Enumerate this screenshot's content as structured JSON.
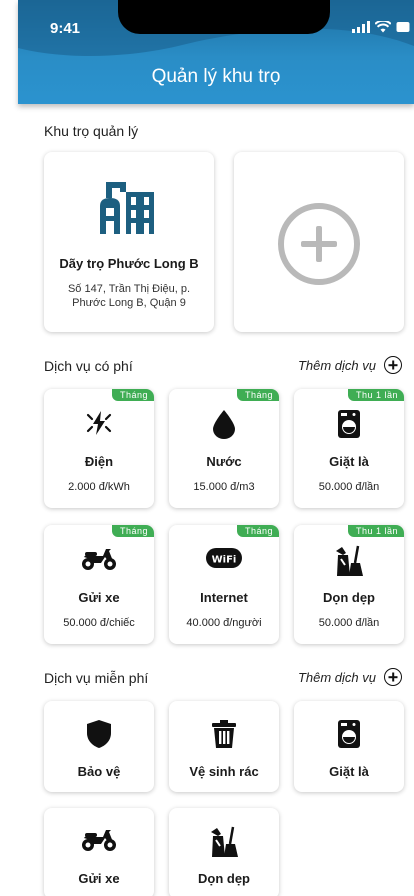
{
  "status": {
    "time": "9:41"
  },
  "header": {
    "title": "Quản lý khu trọ"
  },
  "properties": {
    "section_title": "Khu trọ quản lý",
    "items": [
      {
        "name": "Dãy trọ Phước Long B",
        "address": "Số 147, Trần Thị Điệu, p. Phước Long B, Quận 9",
        "icon": "building-icon"
      }
    ],
    "add_icon": "add-circle-icon"
  },
  "paid_services": {
    "section_title": "Dịch vụ có phí",
    "add_label": "Thêm dịch vụ",
    "items": [
      {
        "name": "Điện",
        "price": "2.000 đ/kWh",
        "tag": "Tháng",
        "icon": "electricity-icon"
      },
      {
        "name": "Nước",
        "price": "15.000 đ/m3",
        "tag": "Tháng",
        "icon": "water-drop-icon"
      },
      {
        "name": "Giặt là",
        "price": "50.000 đ/lần",
        "tag": "Thu 1 lần",
        "icon": "washing-machine-icon"
      },
      {
        "name": "Gửi xe",
        "price": "50.000 đ/chiếc",
        "tag": "Tháng",
        "icon": "motorbike-icon"
      },
      {
        "name": "Internet",
        "price": "40.000 đ/người",
        "tag": "Tháng",
        "icon": "wifi-icon"
      },
      {
        "name": "Dọn dẹp",
        "price": "50.000 đ/lần",
        "tag": "Thu 1 lần",
        "icon": "cleaning-icon"
      }
    ]
  },
  "free_services": {
    "section_title": "Dịch vụ miễn phí",
    "add_label": "Thêm dịch vụ",
    "items": [
      {
        "name": "Bảo vệ",
        "icon": "shield-icon"
      },
      {
        "name": "Vệ sinh rác",
        "icon": "trash-icon"
      },
      {
        "name": "Giặt là",
        "icon": "washing-machine-icon"
      },
      {
        "name": "Gửi xe",
        "icon": "motorbike-icon"
      },
      {
        "name": "Dọn dẹp",
        "icon": "cleaning-icon"
      }
    ]
  },
  "colors": {
    "header": "#2a8dc6",
    "tag": "#3fad54",
    "building": "#1d5f80",
    "add": "#b9b9b9"
  }
}
